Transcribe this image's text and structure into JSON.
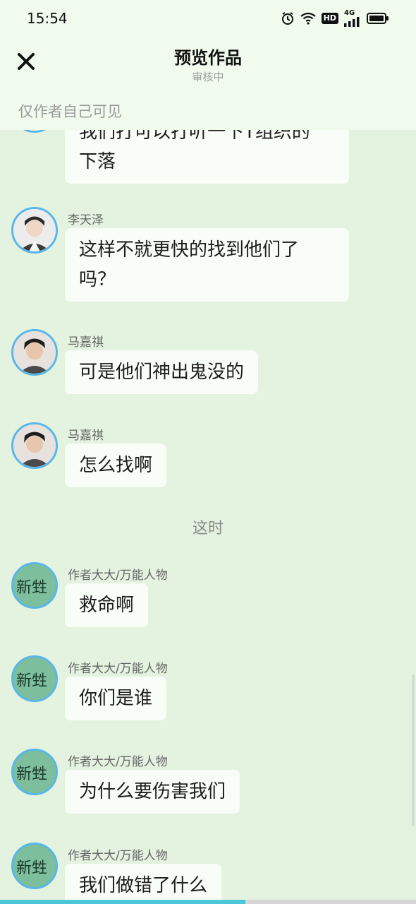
{
  "status_bar": {
    "time": "15:54",
    "hd": "HD",
    "network": "4G",
    "icons": [
      "alarm-icon",
      "wifi-icon",
      "hd-icon",
      "signal-icon",
      "battery-icon"
    ]
  },
  "header": {
    "title": "预览作品",
    "subtitle": "审核中",
    "visibility_note": "仅作者自己可见",
    "close_icon": "close-icon"
  },
  "messages": [
    {
      "sender": "",
      "text_line1": "我们打可以打听一下T组织的",
      "text_line2": "下落"
    },
    {
      "sender": "李天泽",
      "text_line1": "这样不就更快的找到他们了",
      "text_line2": "吗？"
    },
    {
      "sender": "马嘉祺",
      "text": "可是他们神出鬼没的"
    },
    {
      "sender": "马嘉祺",
      "text": "怎么找啊"
    },
    {
      "system": "这时"
    },
    {
      "sender": "作者大大/万能人物",
      "text": "救命啊"
    },
    {
      "sender": "作者大大/万能人物",
      "text": "你们是谁"
    },
    {
      "sender": "作者大大/万能人物",
      "text": "为什么要伤害我们"
    },
    {
      "sender": "作者大大/万能人物",
      "text": "我们做错了什么"
    }
  ],
  "author_avatar_text": "新甡",
  "colors": {
    "background": "#e3f3df",
    "header": "#f0fbee",
    "bubble": "#f9fdf8",
    "avatar_ring": "#5ab6ea",
    "author_avatar_bg": "#7dbf9c",
    "progress": "#4cc7d9"
  },
  "progress": {
    "value": 0.59
  }
}
